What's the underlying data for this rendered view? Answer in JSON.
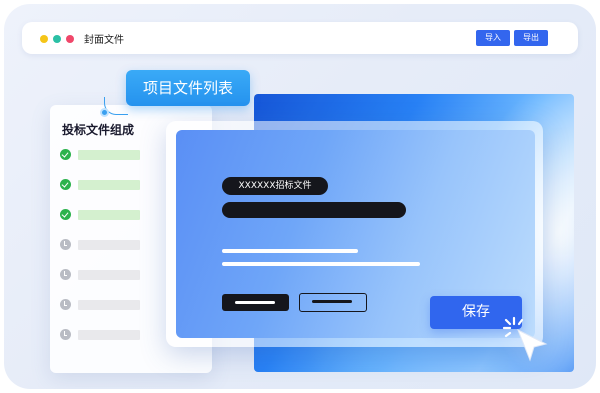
{
  "titlebar": {
    "title": "封面文件",
    "import_label": "导入",
    "export_label": "导出"
  },
  "tooltip": {
    "label": "项目文件列表"
  },
  "list_panel": {
    "title": "投标文件组成",
    "items": [
      {
        "status": "done",
        "icon": "check-circle-icon"
      },
      {
        "status": "done",
        "icon": "check-circle-icon"
      },
      {
        "status": "done",
        "icon": "check-circle-icon"
      },
      {
        "status": "pending",
        "icon": "clock-icon"
      },
      {
        "status": "pending",
        "icon": "clock-icon"
      },
      {
        "status": "pending",
        "icon": "clock-icon"
      },
      {
        "status": "pending",
        "icon": "clock-icon"
      }
    ]
  },
  "card": {
    "pill_label": "XXXXXX招标文件",
    "save_label": "保存"
  },
  "colors": {
    "accent": "#3066ee",
    "tooltip": "#2592ee",
    "done": "#2bb24c",
    "pending": "#b9bcc4"
  }
}
